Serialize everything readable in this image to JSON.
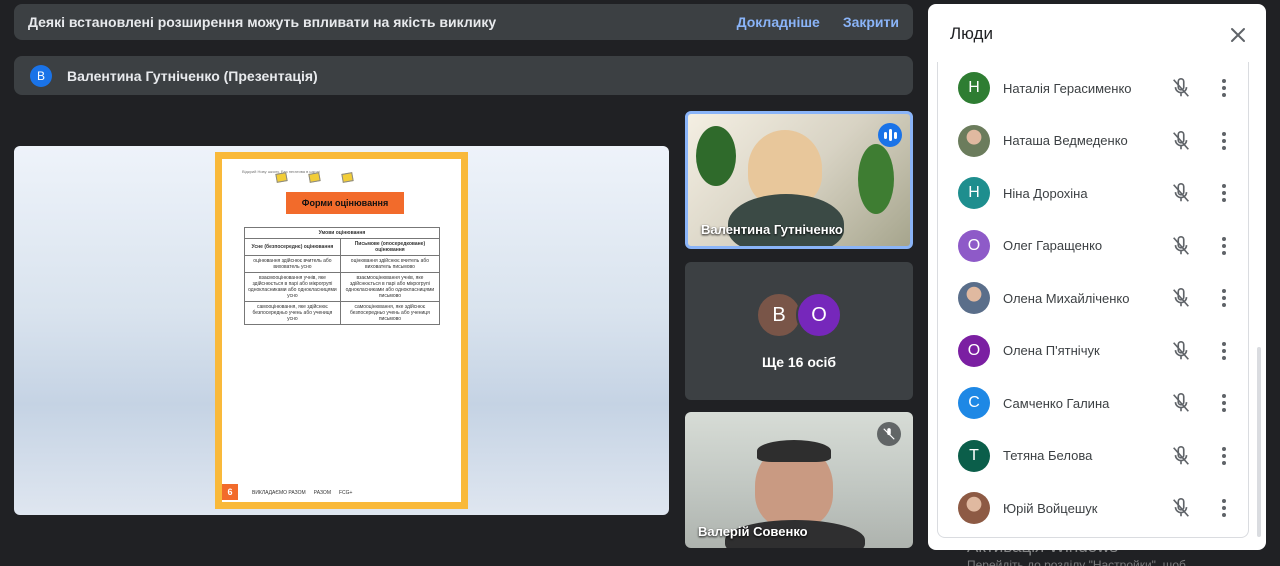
{
  "notice": {
    "message": "Деякі встановлені розширення можуть впливати на якість виклику",
    "learn_more": "Докладніше",
    "close": "Закрити"
  },
  "presenter": {
    "avatar_letter": "В",
    "label": "Валентина Гутніченко (Презентація)"
  },
  "slide": {
    "small_header": "Відкрий Нову школу. Без негатива в школі",
    "title": "Форми оцінювання",
    "table_header": "Умови оцінювання",
    "col1": "Усне (безпосереднє) оцінювання",
    "col2": "Письмове (опосередковане) оцінювання",
    "rows": [
      [
        "оцінювання здійснює вчитель або вихователь усно",
        "оцінювання здійснює вчитель або вихователь письмово"
      ],
      [
        "взаємооцінювання учнів, яке здійснюється в парі або мікрогрупі однокласниками або однокласницями усно",
        "взаємооцінювання учнів, яке здійснюється в парі або мікрогрупі однокласниками або однокласницями письмово"
      ],
      [
        "самооцінювання, яке здійснює безпосередньо учень або учениця усно",
        "самооцінювання, яке здійснює безпосередньо учень або учениця письмово"
      ]
    ],
    "footer_logos": [
      "ВИКЛАДАЄМО РАЗОМ",
      "РАЗОМ",
      "FCG+"
    ],
    "page_number": "6"
  },
  "tiles": {
    "main_speaker": "Валентина Гутніченко",
    "group_avatars": [
      {
        "letter": "В",
        "color": "#795548"
      },
      {
        "letter": "О",
        "color": "#7627bb"
      }
    ],
    "more_label": "Ще 16 осіб",
    "third_name": "Валерій Совенко"
  },
  "people_panel": {
    "title": "Люди",
    "participants": [
      {
        "name": "Наталія Герасименко",
        "letter": "Н",
        "color": "#2e7d32",
        "photo": false
      },
      {
        "name": "Наташа Ведмеденко",
        "letter": "",
        "color": "#6b7c5c",
        "photo": true
      },
      {
        "name": "Ніна Дорохіна",
        "letter": "Н",
        "color": "#1e8e8e",
        "photo": false
      },
      {
        "name": "Олег Гаращенко",
        "letter": "О",
        "color": "#8e5ac8",
        "photo": false
      },
      {
        "name": "Олена Михайліченко",
        "letter": "",
        "color": "#5a6e8a",
        "photo": true
      },
      {
        "name": "Олена П'ятнічук",
        "letter": "О",
        "color": "#7b1fa2",
        "photo": false
      },
      {
        "name": "Самченко Галина",
        "letter": "С",
        "color": "#1e88e5",
        "photo": false
      },
      {
        "name": "Тетяна Белова",
        "letter": "Т",
        "color": "#0b5e4a",
        "photo": false
      },
      {
        "name": "Юрій Войцешук",
        "letter": "",
        "color": "#8d5a44",
        "photo": true
      }
    ]
  },
  "watermark": {
    "line1": "Активація Windows",
    "line2": "Перейдіть до розділу \"Настройки\", щоб"
  }
}
